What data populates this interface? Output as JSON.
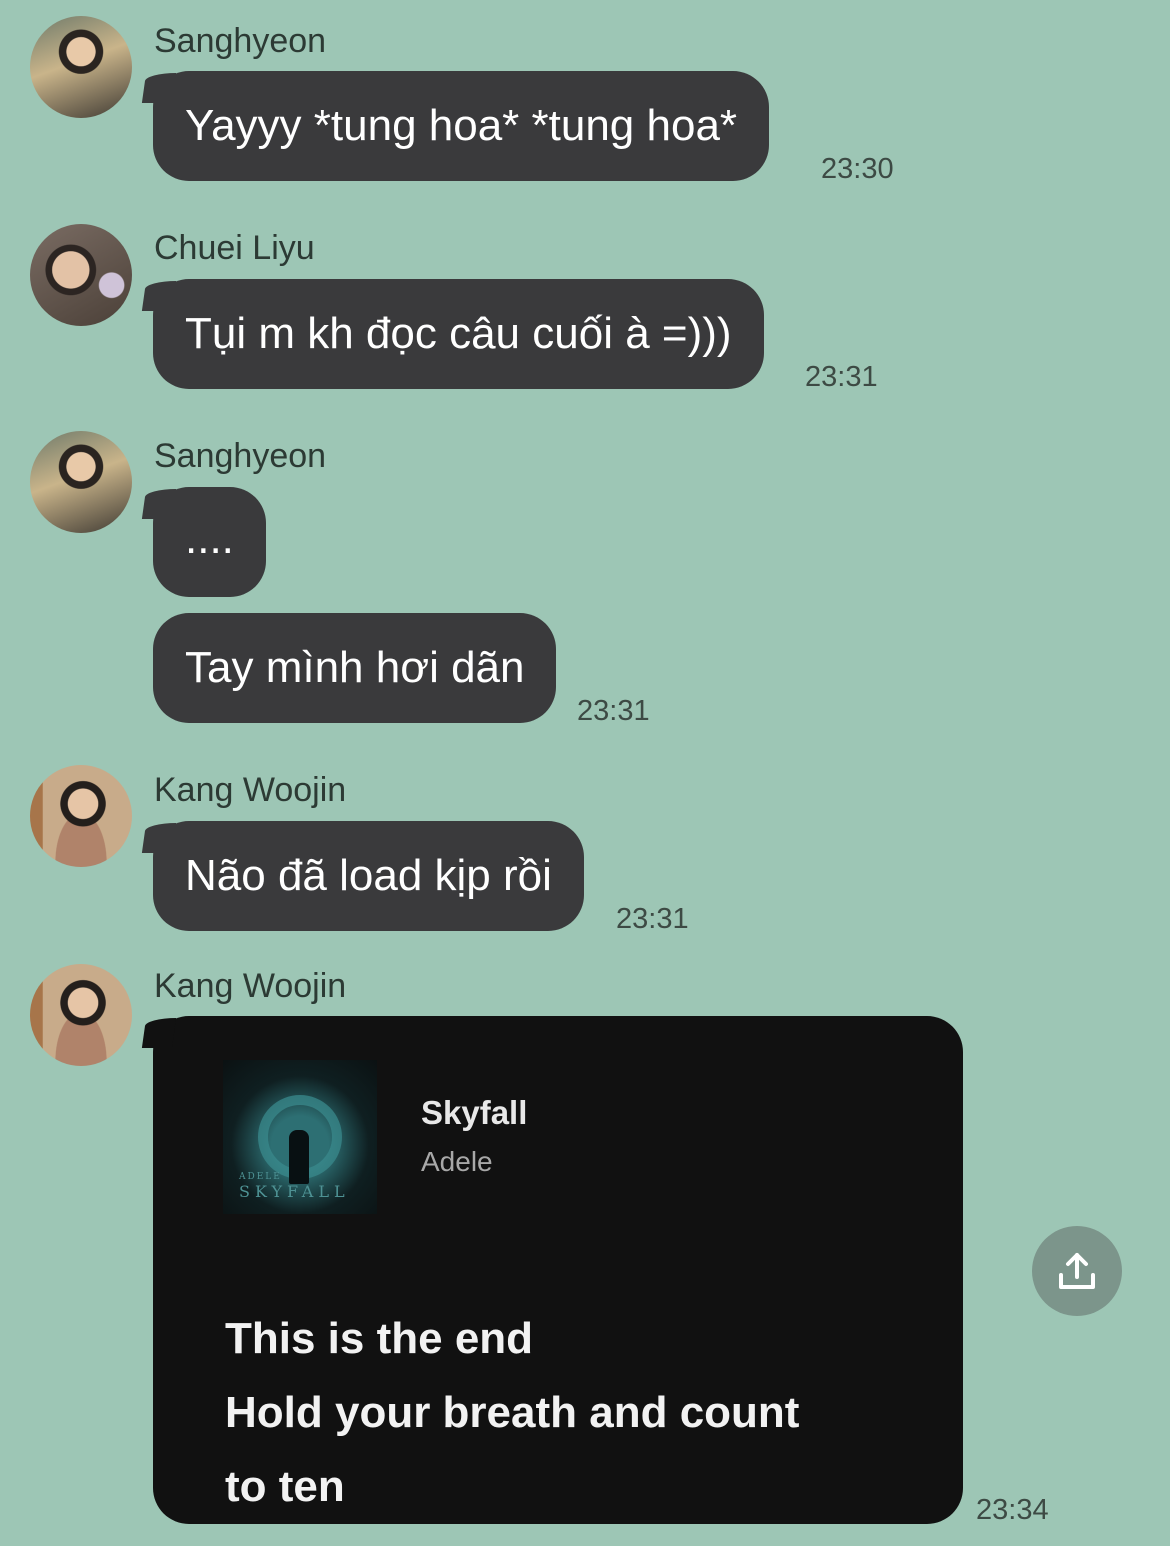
{
  "messages": [
    {
      "sender": "Sanghyeon",
      "avatar": "sanghyeon-avatar",
      "bubbles": [
        "Yayyy *tung hoa* *tung hoa*"
      ],
      "time": "23:30"
    },
    {
      "sender": "Chuei Liyu",
      "avatar": "chuei-liyu-avatar",
      "bubbles": [
        "Tụi m kh đọc câu cuối à =)))"
      ],
      "time": "23:31"
    },
    {
      "sender": "Sanghyeon",
      "avatar": "sanghyeon-avatar",
      "bubbles": [
        "....",
        "Tay mình hơi dãn"
      ],
      "time": "23:31"
    },
    {
      "sender": "Kang Woojin",
      "avatar": "kang-woojin-avatar",
      "bubbles": [
        "Não đã load kịp rồi"
      ],
      "time": "23:31"
    },
    {
      "sender": "Kang Woojin",
      "avatar": "kang-woojin-avatar",
      "time": "23:34",
      "share_card": {
        "song_title": "Skyfall",
        "artist": "Adele",
        "cover_text_artist": "ADELE",
        "cover_text_title": "SKYFALL",
        "lyrics": [
          "This is the end",
          "Hold your breath and count",
          "to ten"
        ]
      }
    }
  ],
  "share_button_icon": "share-upload-icon",
  "colors": {
    "background": "#9dc6b5",
    "bubble": "#3a3a3c",
    "card": "#111111",
    "share_button": "#7c958b"
  }
}
